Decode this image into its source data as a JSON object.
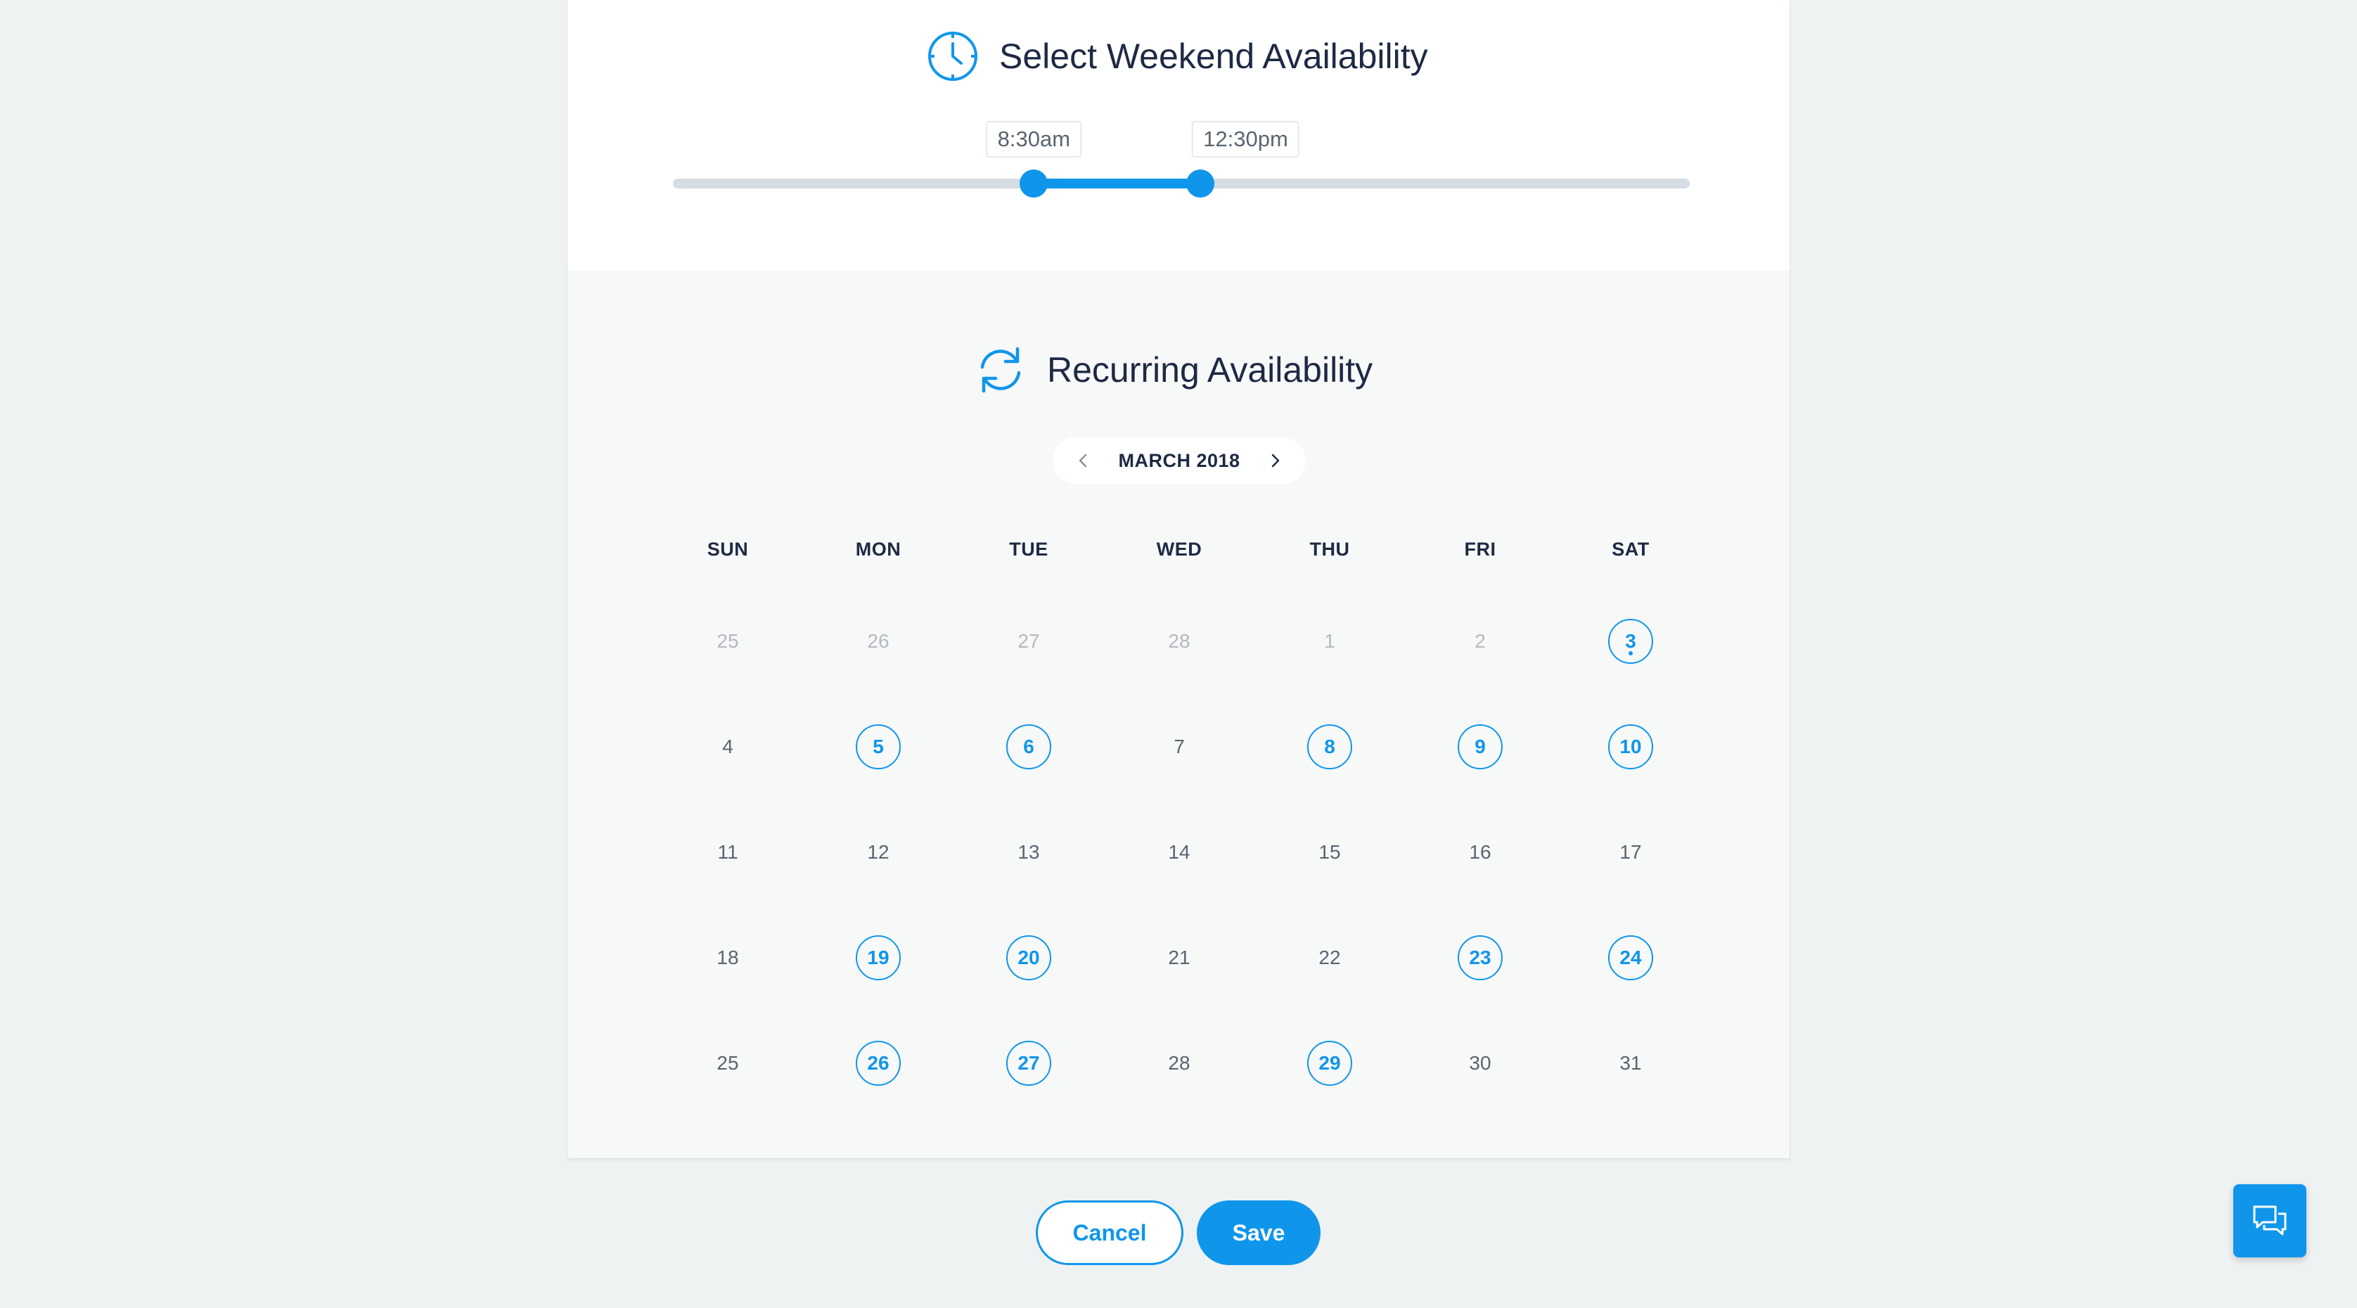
{
  "weekend": {
    "title": "Select Weekend Availability",
    "start_label": "8:30am",
    "end_label": "12:30pm",
    "range_fraction": [
      0.355,
      0.519
    ]
  },
  "recurring": {
    "title": "Recurring Availability",
    "month": "MARCH 2018",
    "weekdays": [
      "SUN",
      "MON",
      "TUE",
      "WED",
      "THU",
      "FRI",
      "SAT"
    ],
    "weeks": [
      [
        {
          "d": "25",
          "m": true
        },
        {
          "d": "26",
          "m": true
        },
        {
          "d": "27",
          "m": true
        },
        {
          "d": "28",
          "m": true
        },
        {
          "d": "1",
          "m": true
        },
        {
          "d": "2",
          "m": true
        },
        {
          "d": "3",
          "s": true,
          "t": true
        }
      ],
      [
        {
          "d": "4"
        },
        {
          "d": "5",
          "s": true
        },
        {
          "d": "6",
          "s": true
        },
        {
          "d": "7"
        },
        {
          "d": "8",
          "s": true
        },
        {
          "d": "9",
          "s": true
        },
        {
          "d": "10",
          "s": true
        }
      ],
      [
        {
          "d": "11"
        },
        {
          "d": "12"
        },
        {
          "d": "13"
        },
        {
          "d": "14"
        },
        {
          "d": "15"
        },
        {
          "d": "16"
        },
        {
          "d": "17"
        }
      ],
      [
        {
          "d": "18"
        },
        {
          "d": "19",
          "s": true
        },
        {
          "d": "20",
          "s": true
        },
        {
          "d": "21"
        },
        {
          "d": "22"
        },
        {
          "d": "23",
          "s": true
        },
        {
          "d": "24",
          "s": true
        }
      ],
      [
        {
          "d": "25"
        },
        {
          "d": "26",
          "s": true
        },
        {
          "d": "27",
          "s": true
        },
        {
          "d": "28"
        },
        {
          "d": "29",
          "s": true
        },
        {
          "d": "30"
        },
        {
          "d": "31"
        }
      ]
    ]
  },
  "actions": {
    "cancel_label": "Cancel",
    "save_label": "Save"
  },
  "icons": {
    "clock": "clock-icon",
    "recurring": "refresh-icon",
    "prev": "chevron-left-icon",
    "next": "chevron-right-icon",
    "chat": "chat-icon"
  },
  "colors": {
    "accent": "#0f96eb",
    "text": "#1e2a44",
    "muted": "#b4b9bf"
  }
}
